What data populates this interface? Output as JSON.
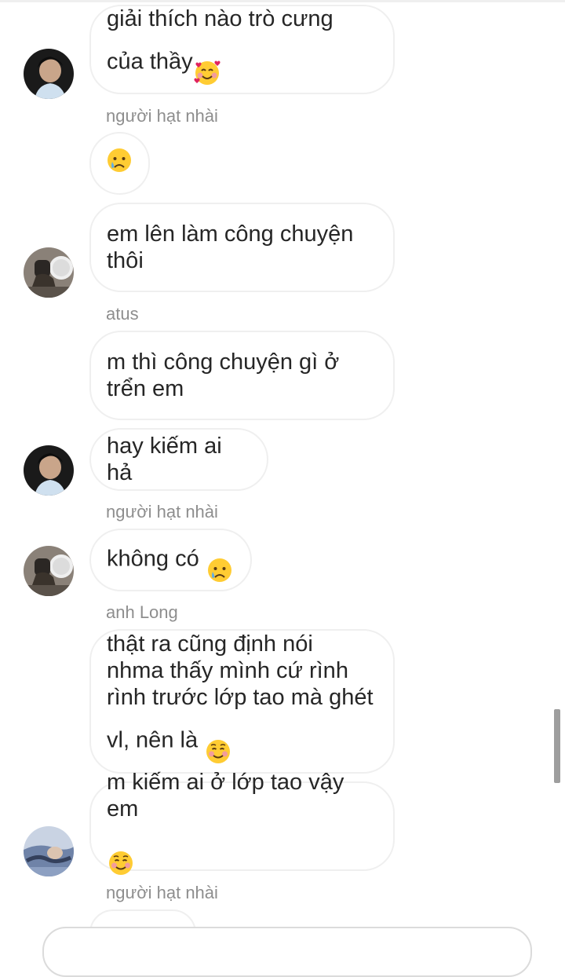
{
  "messages": [
    {
      "text": "giải thích nào trò cưng\ncủa thầy"
    },
    {
      "sender": "người hạt nhài"
    },
    {
      "text": ""
    },
    {
      "text": "em lên làm công chuyện\nthôi"
    },
    {
      "sender": "atus"
    },
    {
      "text": "m thì công chuyện gì ở\ntrển em"
    },
    {
      "text": "hay kiếm ai hả"
    },
    {
      "sender": "người hạt nhài"
    },
    {
      "text": "không có "
    },
    {
      "sender": "anh Long"
    },
    {
      "text": "thật ra cũng định nói\nnhma thấy mình cứ rình\nrình trước lớp tao mà ghét\nvl, nên là "
    },
    {
      "text": "m kiếm ai ở lớp tao vậy em\n"
    },
    {
      "sender": "người hạt nhài"
    }
  ],
  "emojis": {
    "m0": "smiling-face-with-hearts",
    "m2": "crying-face",
    "m8": "crying-face",
    "m10": "smiling-face",
    "m11": "smiling-face"
  },
  "colors": {
    "bubble_border": "#efefef",
    "text": "#262626",
    "sender": "#8e8e8e"
  }
}
